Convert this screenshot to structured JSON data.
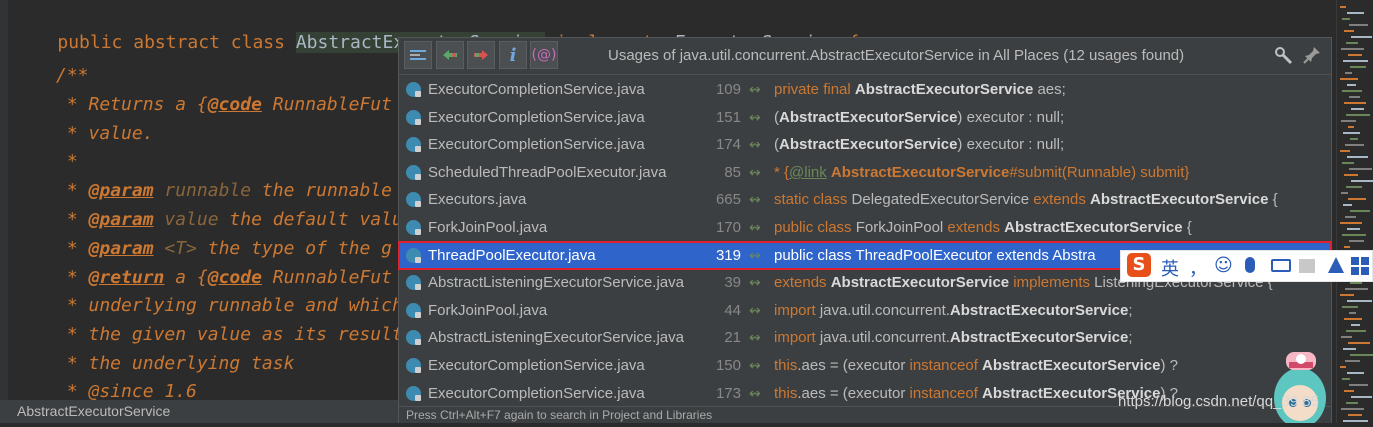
{
  "editor": {
    "decl": {
      "kw1": "public",
      "kw2": "abstract",
      "kw3": "class",
      "name": "AbstractExecutorService",
      "kw4": "implements",
      "iface": "ExecutorService",
      "brace": "{"
    },
    "lines": [
      {
        "t": "/**"
      },
      {
        "t": " * Returns a {",
        "tag": "@code",
        "rest": " RunnableFut"
      },
      {
        "t": " * value."
      },
      {
        "t": " *"
      },
      {
        "t": " * ",
        "tag": "@param",
        "par": " runnable",
        "rest": " the runnable"
      },
      {
        "t": " * ",
        "tag": "@param",
        "par": " value",
        "rest": " the default valu"
      },
      {
        "t": " * ",
        "tag": "@param",
        "par": " <T>",
        "rest": " the type of the g"
      },
      {
        "t": " * ",
        "tag": "@return",
        "rest": " a {",
        "tag2": "@code",
        "rest2": " RunnableFut"
      },
      {
        "t": " * underlying runnable and which"
      },
      {
        "t": " * the given value as its result"
      },
      {
        "t": " * the underlying task"
      },
      {
        "t": " * @since 1.6"
      }
    ],
    "breadcrumb": "AbstractExecutorService"
  },
  "popup": {
    "title": "Usages of java.util.concurrent.AbstractExecutorService in All Places (12 usages found)",
    "status": "Press Ctrl+Alt+F7 again to search in Project and Libraries",
    "toolbar_icons": [
      "merge-icon",
      "previous-occurrence-icon",
      "next-occurrence-icon",
      "info-icon",
      "regex-icon"
    ],
    "settings_icon": "settings-icon",
    "pin_icon": "pin-icon",
    "rows": [
      {
        "file": "ExecutorCompletionService.java",
        "line": "109",
        "parts": [
          [
            "kw",
            "private final "
          ],
          [
            "b",
            "AbstractExecutorService"
          ],
          [
            "n",
            " aes;"
          ]
        ]
      },
      {
        "file": "ExecutorCompletionService.java",
        "line": "151",
        "parts": [
          [
            "n",
            "("
          ],
          [
            "b",
            "AbstractExecutorService"
          ],
          [
            "n",
            ") executor : null;"
          ]
        ]
      },
      {
        "file": "ExecutorCompletionService.java",
        "line": "174",
        "parts": [
          [
            "n",
            "("
          ],
          [
            "b",
            "AbstractExecutorService"
          ],
          [
            "n",
            ") executor : null;"
          ]
        ]
      },
      {
        "file": "ScheduledThreadPoolExecutor.java",
        "line": "85",
        "parts": [
          [
            "kw",
            "* {"
          ],
          [
            "g",
            "@link"
          ],
          [
            "n",
            " "
          ],
          [
            "bo",
            "AbstractExecutorService"
          ],
          [
            "kw",
            "#submit(Runnable) submit}"
          ]
        ]
      },
      {
        "file": "Executors.java",
        "line": "665",
        "parts": [
          [
            "kw",
            "static class "
          ],
          [
            "n",
            "DelegatedExecutorService "
          ],
          [
            "kw",
            "extends "
          ],
          [
            "b",
            "AbstractExecutorService"
          ],
          [
            "n",
            " {"
          ]
        ]
      },
      {
        "file": "ForkJoinPool.java",
        "line": "170",
        "parts": [
          [
            "kw",
            "public class "
          ],
          [
            "n",
            "ForkJoinPool "
          ],
          [
            "kw",
            "extends "
          ],
          [
            "b",
            "AbstractExecutorService"
          ],
          [
            "n",
            " {"
          ]
        ]
      },
      {
        "file": "ThreadPoolExecutor.java",
        "line": "319",
        "selected": true,
        "parts": [
          [
            "n",
            "public class ThreadPoolExecutor extends Abstra"
          ]
        ]
      },
      {
        "file": "AbstractListeningExecutorService.java",
        "line": "39",
        "parts": [
          [
            "kw",
            "extends "
          ],
          [
            "b",
            "AbstractExecutorService"
          ],
          [
            "kw",
            " implements "
          ],
          [
            "n",
            "ListeningExecutorService {"
          ]
        ]
      },
      {
        "file": "ForkJoinPool.java",
        "line": "44",
        "parts": [
          [
            "kw",
            "import "
          ],
          [
            "n",
            "java.util.concurrent."
          ],
          [
            "b",
            "AbstractExecutorService"
          ],
          [
            "n",
            ";"
          ]
        ]
      },
      {
        "file": "AbstractListeningExecutorService.java",
        "line": "21",
        "parts": [
          [
            "kw",
            "import "
          ],
          [
            "n",
            "java.util.concurrent."
          ],
          [
            "b",
            "AbstractExecutorService"
          ],
          [
            "n",
            ";"
          ]
        ]
      },
      {
        "file": "ExecutorCompletionService.java",
        "line": "150",
        "parts": [
          [
            "kw",
            "this"
          ],
          [
            "n",
            ".aes = (executor "
          ],
          [
            "kw",
            "instanceof "
          ],
          [
            "b",
            "AbstractExecutorService"
          ],
          [
            "n",
            ") ?"
          ]
        ]
      },
      {
        "file": "ExecutorCompletionService.java",
        "line": "173",
        "parts": [
          [
            "kw",
            "this"
          ],
          [
            "n",
            ".aes = (executor "
          ],
          [
            "kw",
            "instanceof "
          ],
          [
            "b",
            "AbstractExecutorService"
          ],
          [
            "n",
            ") ?"
          ]
        ]
      }
    ]
  },
  "ime": {
    "logo": "S",
    "lang": "英",
    "punct": "，",
    "emoji": "☺",
    "mic": "mic-icon",
    "keyboard": "keyboard-icon",
    "shirt": "skin-icon",
    "share": "share-icon",
    "grid": "apps-icon"
  },
  "watermark": "https://blog.csdn.net/qq_39        85"
}
